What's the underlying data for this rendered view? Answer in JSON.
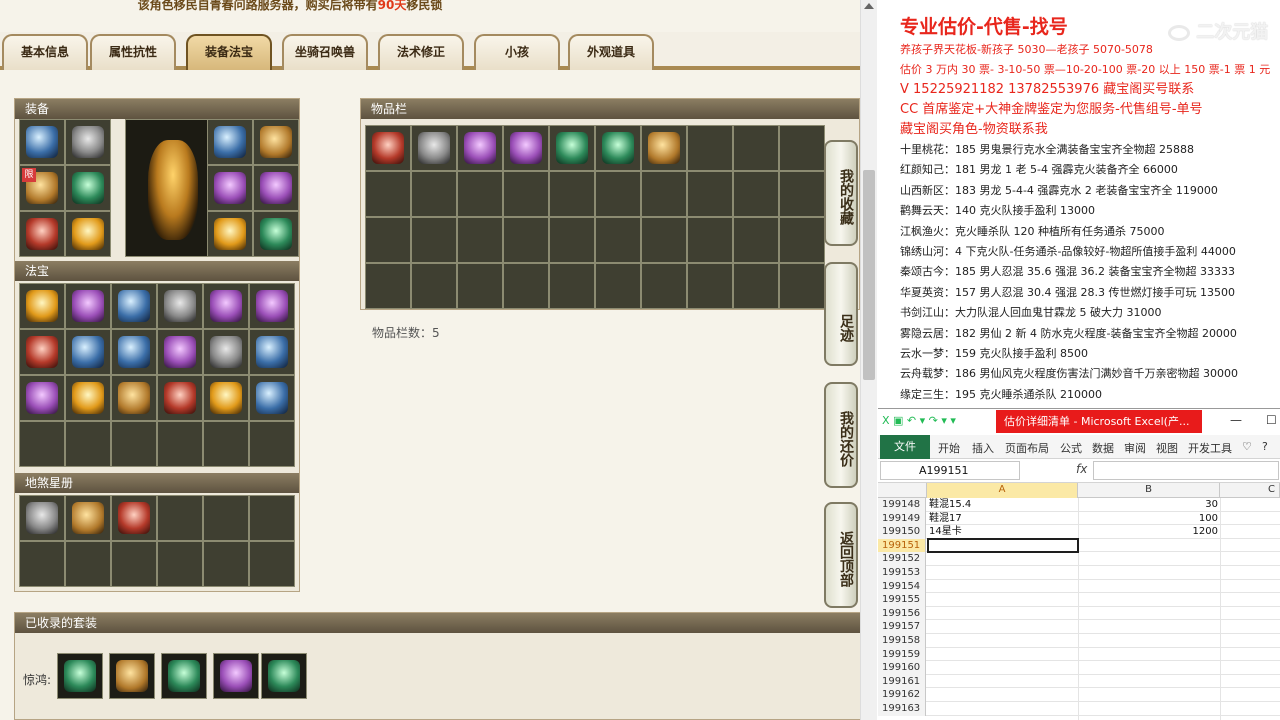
{
  "notice": {
    "prefix": "该角色移民自青春问路服务器，购买后将带有",
    "highlight": "90天",
    "suffix": "移民锁"
  },
  "tabs": [
    "基本信息",
    "属性抗性",
    "装备法宝",
    "坐骑召唤兽",
    "法术修正",
    "小孩",
    "外观道具"
  ],
  "active_tab": "装备法宝",
  "panels": {
    "equip": "装备",
    "fabao": "法宝",
    "starbook": "地煞星册",
    "bag": "物品栏",
    "suits": "已收录的套装"
  },
  "lock_badge": "限",
  "bag_count": "物品栏数：5",
  "suit_label": "惊鸿:",
  "side_buttons": [
    "我的收藏",
    "足迹",
    "我的还价",
    "返回顶部"
  ],
  "notes": {
    "headline": "专业估价-代售-找号",
    "red_lines": [
      "养孩子界天花板-新孩子 5030—老孩子 5070-5078",
      "估价 3 万内 30 票- 3-10-50 票—10-20-100 票-20 以上 150 票-1 票 1 元",
      "V 15225921182        13782553976    藏宝阁买号联系",
      "CC 首席鉴定+大神金牌鉴定为您服务-代售组号-单号",
      "藏宝阁买角色-物资联系我"
    ],
    "lines": [
      "十里桃花：185 男鬼景行克水全满装备宝宝齐全物超 25888",
      "红颜知己：181 男龙 1 老 5-4 强霹克火装备齐全 66000",
      "山西新区：183 男龙 5-4-4 强霹克水 2 老装备宝宝齐全 119000",
      "鹳舞云天：140 克火队接手盈利 13000",
      "江枫渔火：克火睡杀队 120 种植所有任务通杀 75000",
      "锦绣山河：4 下克火队-任务通杀-品像较好-物超所值接手盈利 44000",
      "秦颂古今：185 男人忍混 35.6 强混 36.2 装备宝宝齐全物超 33333",
      "华夏英资：157 男人忍混 30.4 强混 28.3 传世燃灯接手可玩 13500",
      "书剑江山：大力队混人回血鬼甘霖龙 5 破大力 31000",
      "雾隐云居：182 男仙 2 新 4 防水克火程度-装备宝宝齐全物超 20000",
      "云水一梦：159 克火队接手盈利 8500",
      "云舟载梦：186 男仙风克火程度伤害法门满妙音千万亲密物超 30000",
      "缘定三生：195 克火睡杀通杀队 210000"
    ]
  },
  "watermark": "二次元猫",
  "excel": {
    "title": "估价详细清单 - Microsoft Excel(产...",
    "file_tab": "文件",
    "ribbon_tabs": [
      "开始",
      "插入",
      "页面布局",
      "公式",
      "数据",
      "审阅",
      "视图",
      "开发工具"
    ],
    "name_box": "A199151",
    "fx": "fx",
    "columns": [
      "A",
      "B",
      "C"
    ],
    "rows": [
      {
        "n": "199148",
        "a": "鞋混15.4",
        "b": "30"
      },
      {
        "n": "199149",
        "a": "鞋混17",
        "b": "100"
      },
      {
        "n": "199150",
        "a": "14星卡",
        "b": "1200"
      },
      {
        "n": "199151",
        "a": "",
        "b": ""
      },
      {
        "n": "199152",
        "a": "",
        "b": ""
      },
      {
        "n": "199153",
        "a": "",
        "b": ""
      },
      {
        "n": "199154",
        "a": "",
        "b": ""
      },
      {
        "n": "199155",
        "a": "",
        "b": ""
      },
      {
        "n": "199156",
        "a": "",
        "b": ""
      },
      {
        "n": "199157",
        "a": "",
        "b": ""
      },
      {
        "n": "199158",
        "a": "",
        "b": ""
      },
      {
        "n": "199159",
        "a": "",
        "b": ""
      },
      {
        "n": "199160",
        "a": "",
        "b": ""
      },
      {
        "n": "199161",
        "a": "",
        "b": ""
      },
      {
        "n": "199162",
        "a": "",
        "b": ""
      },
      {
        "n": "199163",
        "a": "",
        "b": ""
      }
    ],
    "selected_row": "199151"
  }
}
